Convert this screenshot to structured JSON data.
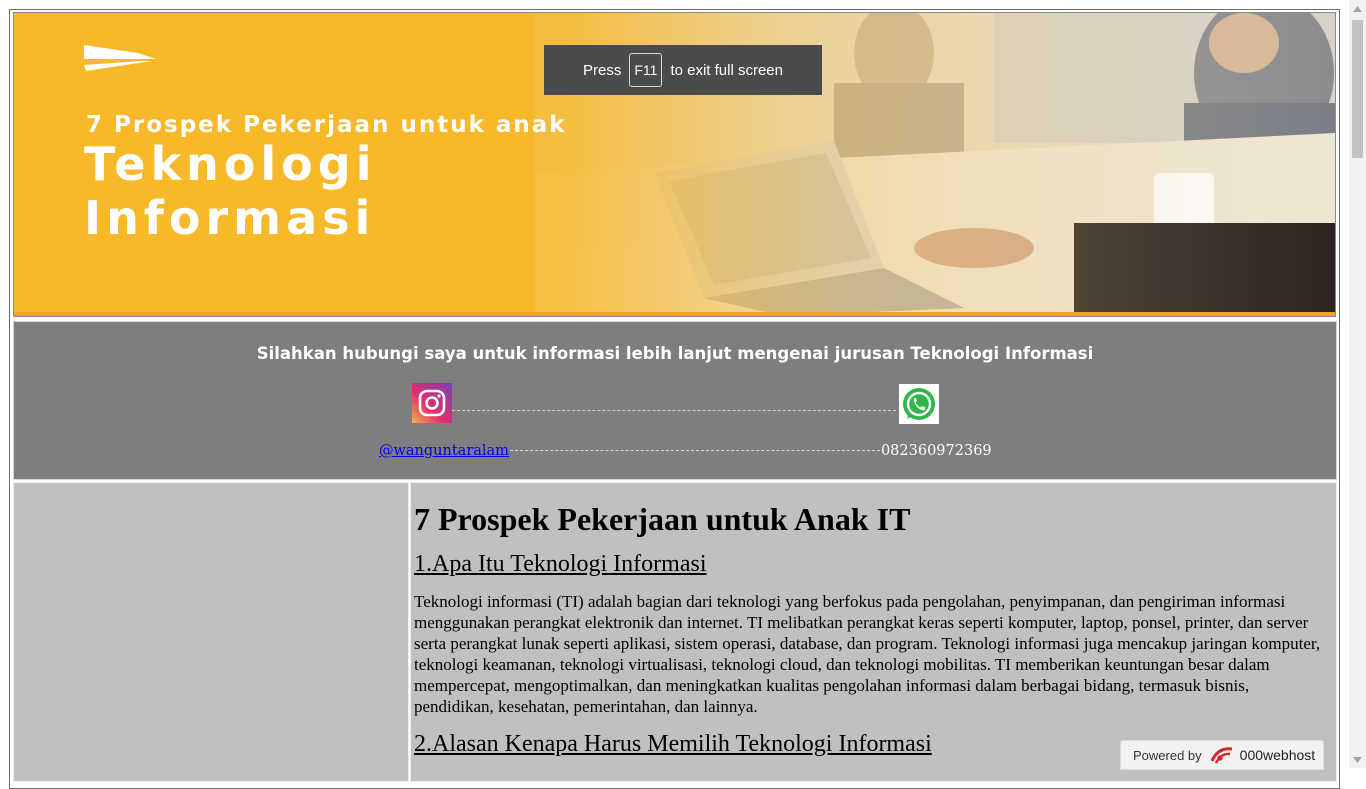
{
  "banner": {
    "subtitle": "7 Prospek Pekerjaan untuk  anak",
    "title_line1": "Teknologi",
    "title_line2": "Informasi"
  },
  "fullscreen_toast": {
    "before": "Press",
    "key": "F11",
    "after": "to exit full screen"
  },
  "contact": {
    "heading": "Silahkan hubungi saya untuk informasi lebih lanjut mengenai jurusan Teknologi Informasi",
    "instagram_handle": "@wanguntaralam",
    "phone": "082360972369",
    "icons": [
      "instagram-icon",
      "whatsapp-icon"
    ]
  },
  "article": {
    "title": "7 Prospek Pekerjaan untuk Anak IT",
    "section1_heading": "1.Apa Itu Teknologi Informasi",
    "section1_body": "Teknologi informasi (TI) adalah bagian dari teknologi yang berfokus pada pengolahan, penyimpanan, dan pengiriman informasi menggunakan perangkat elektronik dan internet. TI melibatkan perangkat keras seperti komputer, laptop, ponsel, printer, dan server serta perangkat lunak seperti aplikasi, sistem operasi, database, dan program. Teknologi informasi juga mencakup jaringan komputer, teknologi keamanan, teknologi virtualisasi, teknologi cloud, dan teknologi mobilitas. TI memberikan keuntungan besar dalam mempercepat, mengoptimalkan, dan meningkatkan kualitas pengolahan informasi dalam berbagai bidang, termasuk bisnis, pendidikan, kesehatan, pemerintahan, dan lainnya.",
    "section2_heading": "2.Alasan Kenapa Harus Memilih Teknologi Informasi"
  },
  "badge": {
    "powered_by": "Powered by",
    "host": "000webhost"
  },
  "colors": {
    "banner_yellow": "#f7b82a",
    "contact_bg": "#7e7e7e",
    "content_bg": "#c0c0c0",
    "toast_bg": "#4b4b4b"
  }
}
